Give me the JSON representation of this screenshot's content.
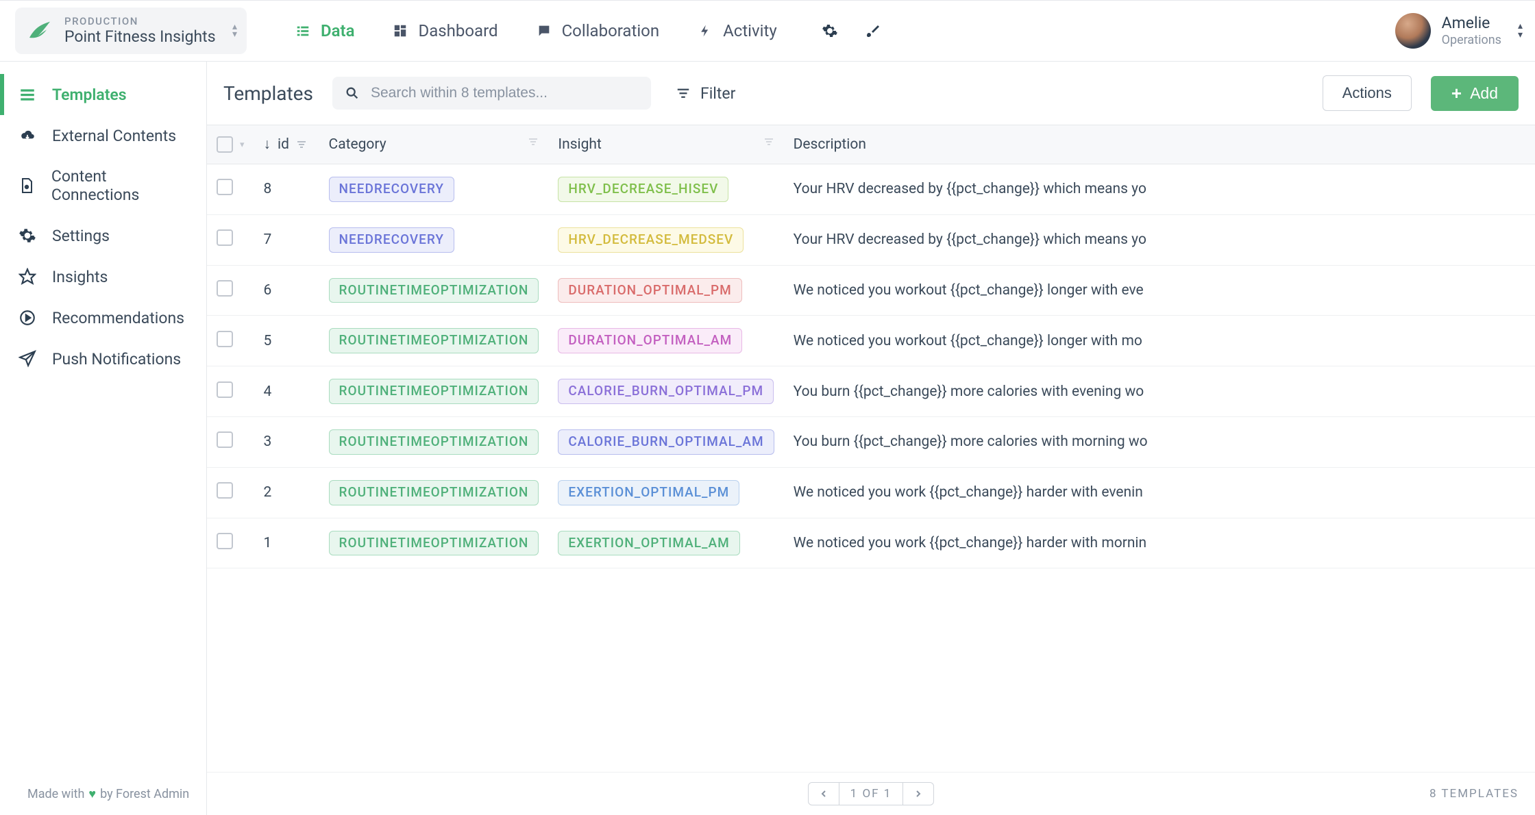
{
  "header": {
    "env": "PRODUCTION",
    "project": "Point Fitness Insights",
    "tabs": [
      {
        "label": "Data",
        "active": true
      },
      {
        "label": "Dashboard",
        "active": false
      },
      {
        "label": "Collaboration",
        "active": false
      },
      {
        "label": "Activity",
        "active": false
      }
    ],
    "user": {
      "name": "Amelie",
      "role": "Operations"
    }
  },
  "sidebar": {
    "items": [
      {
        "label": "Templates",
        "active": true,
        "icon": "list"
      },
      {
        "label": "External Contents",
        "active": false,
        "icon": "cloud-download"
      },
      {
        "label": "Content Connections",
        "active": false,
        "icon": "file-video"
      },
      {
        "label": "Settings",
        "active": false,
        "icon": "gear"
      },
      {
        "label": "Insights",
        "active": false,
        "icon": "star"
      },
      {
        "label": "Recommendations",
        "active": false,
        "icon": "play-circle"
      },
      {
        "label": "Push Notifications",
        "active": false,
        "icon": "send"
      }
    ],
    "footer_prefix": "Made with",
    "footer_suffix": "by Forest Admin"
  },
  "toolbar": {
    "title": "Templates",
    "search_placeholder": "Search within 8 templates...",
    "filter_label": "Filter",
    "actions_label": "Actions",
    "add_label": "Add"
  },
  "columns": {
    "id": "id",
    "category": "Category",
    "insight": "Insight",
    "description": "Description"
  },
  "pill_styles": {
    "NEEDRECOVERY": {
      "fg": "#6a74d8",
      "bg": "#eceefb",
      "bd": "#b7bdee"
    },
    "ROUTINETIMEOPTIMIZATION": {
      "fg": "#4fb07a",
      "bg": "#e8f6ee",
      "bd": "#a9dcbf"
    },
    "HRV_DECREASE_HISEV": {
      "fg": "#7fbf4b",
      "bg": "#f2f9e9",
      "bd": "#c6e3a5"
    },
    "HRV_DECREASE_MEDSEV": {
      "fg": "#d3bb3d",
      "bg": "#fdfae6",
      "bd": "#ece19c"
    },
    "DURATION_OPTIMAL_PM": {
      "fg": "#d96b6b",
      "bg": "#fbecec",
      "bd": "#eebcbc"
    },
    "DURATION_OPTIMAL_AM": {
      "fg": "#c35fc0",
      "bg": "#faecf9",
      "bd": "#e8b8e6"
    },
    "CALORIE_BURN_OPTIMAL_PM": {
      "fg": "#8a6fd8",
      "bg": "#f1edfb",
      "bd": "#c9bdee"
    },
    "CALORIE_BURN_OPTIMAL_AM": {
      "fg": "#6a74d8",
      "bg": "#eceefb",
      "bd": "#b7bdee"
    },
    "EXERTION_OPTIMAL_PM": {
      "fg": "#5a8fd6",
      "bg": "#ebf2fa",
      "bd": "#b8d0ee"
    },
    "EXERTION_OPTIMAL_AM": {
      "fg": "#4fb07a",
      "bg": "#e8f6ee",
      "bd": "#a9dcbf"
    }
  },
  "rows": [
    {
      "id": "8",
      "category": "NEEDRECOVERY",
      "insight": "HRV_DECREASE_HISEV",
      "description": "Your HRV decreased by {{pct_change}} which means yo"
    },
    {
      "id": "7",
      "category": "NEEDRECOVERY",
      "insight": "HRV_DECREASE_MEDSEV",
      "description": "Your HRV decreased by {{pct_change}} which means yo"
    },
    {
      "id": "6",
      "category": "ROUTINETIMEOPTIMIZATION",
      "insight": "DURATION_OPTIMAL_PM",
      "description": "We noticed you workout {{pct_change}} longer with eve"
    },
    {
      "id": "5",
      "category": "ROUTINETIMEOPTIMIZATION",
      "insight": "DURATION_OPTIMAL_AM",
      "description": "We noticed you workout {{pct_change}} longer with mo"
    },
    {
      "id": "4",
      "category": "ROUTINETIMEOPTIMIZATION",
      "insight": "CALORIE_BURN_OPTIMAL_PM",
      "description": "You burn {{pct_change}} more calories with evening wo"
    },
    {
      "id": "3",
      "category": "ROUTINETIMEOPTIMIZATION",
      "insight": "CALORIE_BURN_OPTIMAL_AM",
      "description": "You burn {{pct_change}} more calories with morning wo"
    },
    {
      "id": "2",
      "category": "ROUTINETIMEOPTIMIZATION",
      "insight": "EXERTION_OPTIMAL_PM",
      "description": "We noticed you work {{pct_change}} harder with evenin"
    },
    {
      "id": "1",
      "category": "ROUTINETIMEOPTIMIZATION",
      "insight": "EXERTION_OPTIMAL_AM",
      "description": "We noticed you work {{pct_change}} harder with mornin"
    }
  ],
  "footer": {
    "pager": "1 OF 1",
    "count_label": "8 TEMPLATES"
  }
}
